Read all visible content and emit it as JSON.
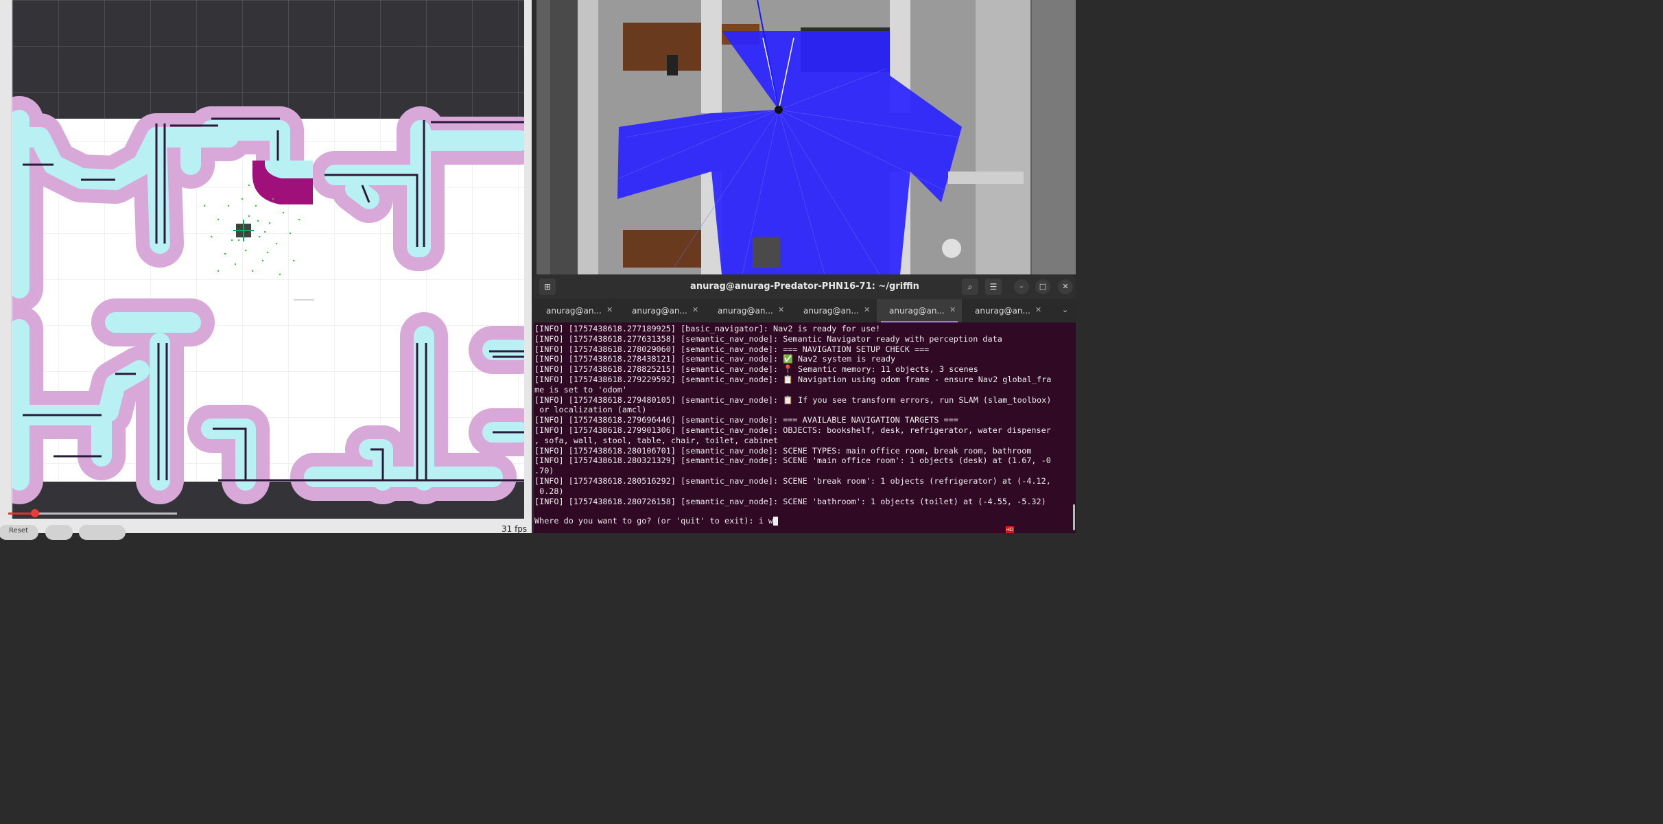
{
  "rviz": {
    "reset_label": "Reset",
    "fps": "31 fps"
  },
  "terminal": {
    "title": "anurag@anurag-Predator-PHN16-71: ~/griffin",
    "tabs": [
      {
        "label": "anurag@an..."
      },
      {
        "label": "anurag@an..."
      },
      {
        "label": "anurag@an..."
      },
      {
        "label": "anurag@an..."
      },
      {
        "label": "anurag@an...",
        "active": true
      },
      {
        "label": "anurag@an..."
      }
    ],
    "log_lines": [
      "[INFO] [1757438618.277189925] [basic_navigator]: Nav2 is ready for use!",
      "[INFO] [1757438618.277631358] [semantic_nav_node]: Semantic Navigator ready with perception data",
      "[INFO] [1757438618.278029060] [semantic_nav_node]: === NAVIGATION SETUP CHECK ===",
      "[INFO] [1757438618.278438121] [semantic_nav_node]: ✅ Nav2 system is ready",
      "[INFO] [1757438618.278825215] [semantic_nav_node]: 📍 Semantic memory: 11 objects, 3 scenes",
      "[INFO] [1757438618.279229592] [semantic_nav_node]: 📋 Navigation using odom frame - ensure Nav2 global_fra",
      "me is set to 'odom'",
      "[INFO] [1757438618.279480105] [semantic_nav_node]: 📋 If you see transform errors, run SLAM (slam_toolbox)",
      " or localization (amcl)",
      "[INFO] [1757438618.279696446] [semantic_nav_node]: === AVAILABLE NAVIGATION TARGETS ===",
      "[INFO] [1757438618.279901306] [semantic_nav_node]: OBJECTS: bookshelf, desk, refrigerator, water dispenser",
      ", sofa, wall, stool, table, chair, toilet, cabinet",
      "[INFO] [1757438618.280106701] [semantic_nav_node]: SCENE TYPES: main office room, break room, bathroom",
      "[INFO] [1757438618.280321329] [semantic_nav_node]: SCENE 'main office room': 1 objects (desk) at (1.67, -0",
      ".70)",
      "[INFO] [1757438618.280516292] [semantic_nav_node]: SCENE 'break room': 1 objects (refrigerator) at (-4.12,",
      " 0.28)",
      "[INFO] [1757438618.280726158] [semantic_nav_node]: SCENE 'bathroom': 1 objects (toilet) at (-4.55, -5.32)"
    ],
    "prompt": "Where do you want to go? (or 'quit' to exit): i w",
    "icons": [
      "new-tab-icon",
      "search-icon",
      "menu-icon",
      "minimize-icon",
      "maximize-icon",
      "close-icon"
    ]
  },
  "taskbar": {
    "hd_badge": "HD"
  }
}
